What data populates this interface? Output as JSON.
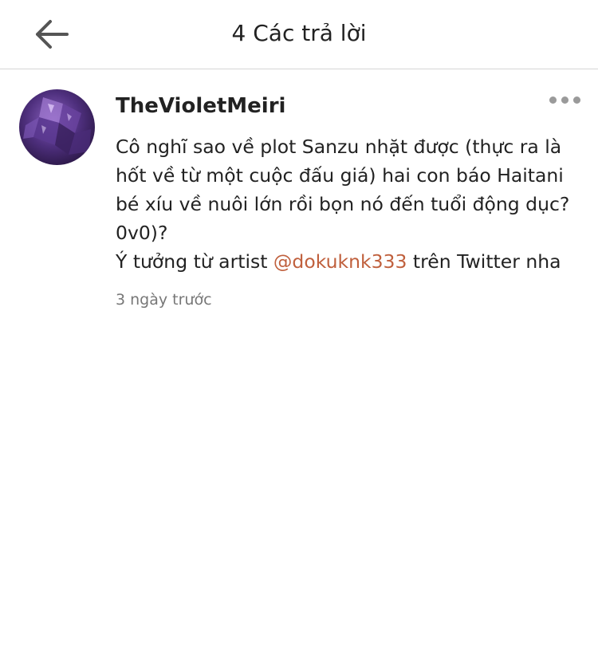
{
  "header": {
    "title": "4 Các trả lời",
    "back_icon": "arrow-left-icon"
  },
  "comment": {
    "author": "TheVioletMeiri",
    "avatar_icon": "amethyst-avatar",
    "more_icon": "more-dots-icon",
    "body_line_1": "Cô nghĩ sao về plot Sanzu nhặt được (thực ra là hốt về từ một cuộc đấu giá) hai con báo Haitani bé xíu về nuôi lớn rồi bọn nó đến tuổi động dục? 0v0)?",
    "body_line_2_prefix": "Ý tưởng từ artist ",
    "mention": "@dokuknk333",
    "body_line_2_suffix": " trên Twitter nha",
    "timestamp": "3 ngày trước"
  },
  "colors": {
    "mention": "#c0603d",
    "divider": "#d6d6d6",
    "meta": "#777777"
  }
}
